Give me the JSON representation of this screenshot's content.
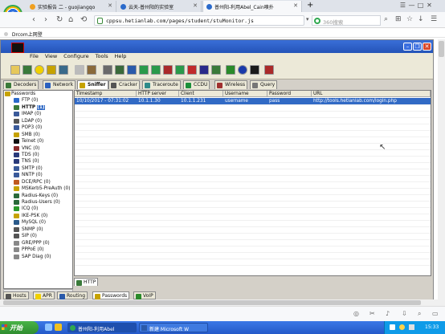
{
  "browser": {
    "tabs": [
      {
        "label": "实验报告 二 - guojiangqo",
        "active": false
      },
      {
        "label": "云天-普州阳的实验室",
        "active": false
      },
      {
        "label": "普州阳-利用Abel_Cain嗅扑",
        "active": true
      }
    ],
    "new_tab": "+",
    "window_controls": [
      "☰",
      "—",
      "□",
      "✕"
    ],
    "address": "cppsu.hetianlab.com/pages/student/stuMonitor.js",
    "search_placeholder": "360搜索",
    "bookmark": "Drcom上网登"
  },
  "app": {
    "title": "",
    "menu": [
      "File",
      "View",
      "Configure",
      "Tools",
      "Help"
    ],
    "top_tabs": [
      {
        "label": "Decoders",
        "color": "#3a7a3a"
      },
      {
        "label": "Network",
        "color": "#2a5fbf"
      },
      {
        "label": "Sniffer",
        "color": "#c6a200"
      },
      {
        "label": "Cracker",
        "color": "#555555"
      },
      {
        "label": "Traceroute",
        "color": "#2d8a8a"
      },
      {
        "label": "CCDU",
        "color": "#1a8f3a"
      },
      {
        "label": "Wireless",
        "color": "#a03030"
      },
      {
        "label": "Query",
        "color": "#777777"
      }
    ],
    "active_top_tab": "Sniffer",
    "tree_root": "Passwords",
    "tree": [
      {
        "label": "FTP",
        "count": "(0)",
        "color": "#2a6acb"
      },
      {
        "label": "HTTP",
        "count": "(1)",
        "color": "#3a7a3a"
      },
      {
        "label": "IMAP",
        "count": "(0)",
        "color": "#3a5a9a"
      },
      {
        "label": "LDAP",
        "count": "(0)",
        "color": "#555555"
      },
      {
        "label": "POP3",
        "count": "(0)",
        "color": "#3a5a9a"
      },
      {
        "label": "SMB",
        "count": "(0)",
        "color": "#c6a200"
      },
      {
        "label": "Telnet",
        "count": "(0)",
        "color": "#111111"
      },
      {
        "label": "VNC",
        "count": "(0)",
        "color": "#8a2a2a"
      },
      {
        "label": "TDS",
        "count": "(0)",
        "color": "#2a3a7a"
      },
      {
        "label": "TNS",
        "count": "(0)",
        "color": "#2a3a7a"
      },
      {
        "label": "SMTP",
        "count": "(0)",
        "color": "#3a5a9a"
      },
      {
        "label": "NNTP",
        "count": "(0)",
        "color": "#3a5a9a"
      },
      {
        "label": "DCE/RPC",
        "count": "(0)",
        "color": "#c05a20"
      },
      {
        "label": "MSKerb5-PreAuth",
        "count": "(0)",
        "color": "#c6a200"
      },
      {
        "label": "Radius-Keys",
        "count": "(0)",
        "color": "#2a6a3a"
      },
      {
        "label": "Radius-Users",
        "count": "(0)",
        "color": "#2a6a3a"
      },
      {
        "label": "ICQ",
        "count": "(0)",
        "color": "#2a9a2a"
      },
      {
        "label": "IKE-PSK",
        "count": "(0)",
        "color": "#c6a200"
      },
      {
        "label": "MySQL",
        "count": "(0)",
        "color": "#2a5a8a"
      },
      {
        "label": "SNMP",
        "count": "(0)",
        "color": "#555555"
      },
      {
        "label": "SIP",
        "count": "(0)",
        "color": "#555555"
      },
      {
        "label": "GRE/PPP",
        "count": "(0)",
        "color": "#888888"
      },
      {
        "label": "PPPoE",
        "count": "(0)",
        "color": "#888888"
      },
      {
        "label": "SAP Diag",
        "count": "(0)",
        "color": "#888888"
      }
    ],
    "grid": {
      "columns": [
        "Timestamp",
        "HTTP server",
        "Client",
        "Username",
        "Password",
        "URL"
      ],
      "rows": [
        [
          "10/10/2017 - 07:31:02",
          "10.1.1.30",
          "10.1.1.231",
          "username",
          "pass",
          "http://tools.hetianlab.com/login.php"
        ]
      ]
    },
    "grid_tab": "HTTP",
    "bottom_tabs": [
      "Hosts",
      "APR",
      "Routing",
      "Passwords",
      "VoIP"
    ],
    "active_bottom_tab": "Passwords"
  },
  "taskbar": {
    "start": "开始",
    "tasks": [
      {
        "label": "普州阳-利用Abel_"
      },
      {
        "label": "新建 Microsoft W"
      }
    ],
    "clock": "15:33"
  }
}
